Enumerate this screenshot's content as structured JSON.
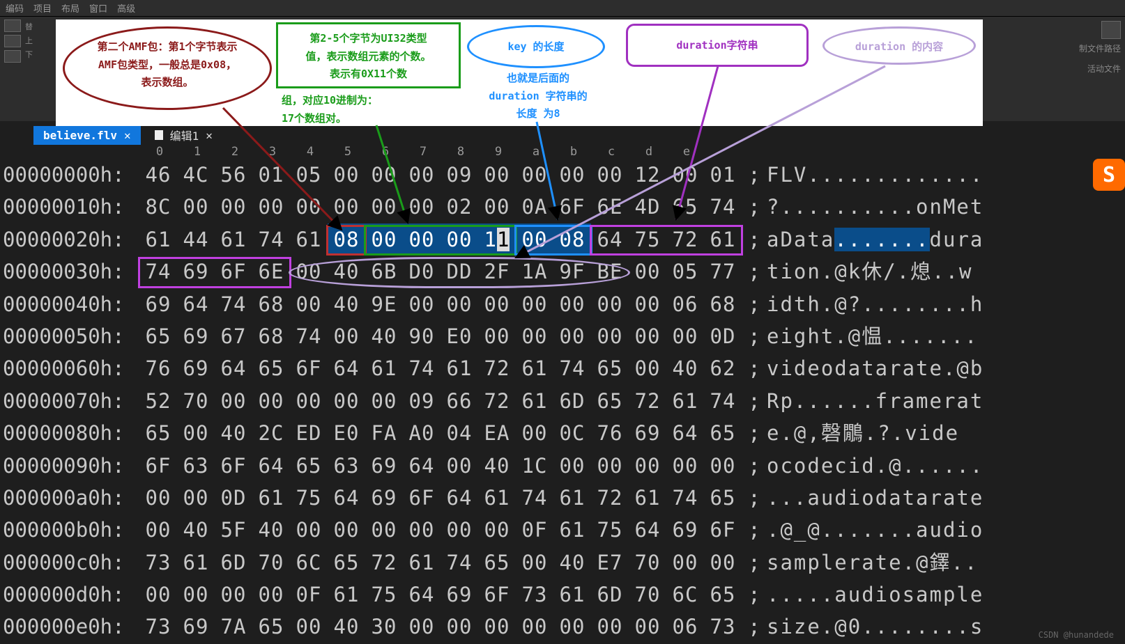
{
  "menu": [
    "编码",
    "项目",
    "布局",
    "窗口",
    "高级"
  ],
  "toolbar": {
    "left_items": [
      {
        "icon": "replace",
        "label": "替"
      },
      {
        "icon": "up",
        "label": "上"
      },
      {
        "icon": "down",
        "label": "下"
      }
    ]
  },
  "right_tools": {
    "line1": "制文件路径",
    "line2": "活动文件"
  },
  "csdn_watermark": "CSDN @hunandede",
  "annotations": {
    "amf_type": {
      "line1": "第二个AMF包：第1个字节表示",
      "line2": "AMF包类型，一般总是0x08，",
      "line3": "表示数组。"
    },
    "ui32": {
      "line1": "第2-5个字节为UI32类型",
      "line2": "值，表示数组元素的个数。",
      "line3": "表示有0X11个数",
      "extra1": "组，对应10进制为：",
      "extra2": "17个数组对。"
    },
    "key_len": {
      "title": "key 的长度",
      "sub1": "也就是后面的",
      "sub2": "duration 字符串的",
      "sub3": "长度 为8"
    },
    "dur_str": "duration字符串",
    "dur_content": "duration 的内容"
  },
  "tabs": [
    {
      "label": "believe.flv",
      "active": true,
      "closable": true
    },
    {
      "label": "编辑1",
      "active": false,
      "icon": true,
      "closable": true
    }
  ],
  "hex": {
    "col_headers": [
      "0",
      "1",
      "2",
      "3",
      "4",
      "5",
      "6",
      "7",
      "8",
      "9",
      "a",
      "b",
      "c",
      "d",
      "e"
    ],
    "rows": [
      {
        "addr": "00000000h:",
        "b": [
          "46",
          "4C",
          "56",
          "01",
          "05",
          "00",
          "00",
          "00",
          "09",
          "00",
          "00",
          "00",
          "00",
          "12",
          "00",
          "01"
        ],
        "a": "FLV............."
      },
      {
        "addr": "00000010h:",
        "b": [
          "8C",
          "00",
          "00",
          "00",
          "00",
          "00",
          "00",
          "00",
          "02",
          "00",
          "0A",
          "6F",
          "6E",
          "4D",
          "65",
          "74"
        ],
        "a": "?..........onMet"
      },
      {
        "addr": "00000020h:",
        "b": [
          "61",
          "44",
          "61",
          "74",
          "61",
          "08",
          "00",
          "00",
          "00",
          "11",
          "00",
          "08",
          "64",
          "75",
          "72",
          "61"
        ],
        "a": "aData.......dura"
      },
      {
        "addr": "00000030h:",
        "b": [
          "74",
          "69",
          "6F",
          "6E",
          "00",
          "40",
          "6B",
          "D0",
          "DD",
          "2F",
          "1A",
          "9F",
          "BE",
          "00",
          "05",
          "77"
        ],
        "a": "tion.@k休/.熄..w"
      },
      {
        "addr": "00000040h:",
        "b": [
          "69",
          "64",
          "74",
          "68",
          "00",
          "40",
          "9E",
          "00",
          "00",
          "00",
          "00",
          "00",
          "00",
          "00",
          "06",
          "68"
        ],
        "a": "idth.@?........h"
      },
      {
        "addr": "00000050h:",
        "b": [
          "65",
          "69",
          "67",
          "68",
          "74",
          "00",
          "40",
          "90",
          "E0",
          "00",
          "00",
          "00",
          "00",
          "00",
          "00",
          "0D"
        ],
        "a": "eight.@愠......."
      },
      {
        "addr": "00000060h:",
        "b": [
          "76",
          "69",
          "64",
          "65",
          "6F",
          "64",
          "61",
          "74",
          "61",
          "72",
          "61",
          "74",
          "65",
          "00",
          "40",
          "62"
        ],
        "a": "videodatarate.@b"
      },
      {
        "addr": "00000070h:",
        "b": [
          "52",
          "70",
          "00",
          "00",
          "00",
          "00",
          "00",
          "09",
          "66",
          "72",
          "61",
          "6D",
          "65",
          "72",
          "61",
          "74"
        ],
        "a": "Rp......framerat"
      },
      {
        "addr": "00000080h:",
        "b": [
          "65",
          "00",
          "40",
          "2C",
          "ED",
          "E0",
          "FA",
          "A0",
          "04",
          "EA",
          "00",
          "0C",
          "76",
          "69",
          "64",
          "65"
        ],
        "a": "e.@,磬鷳.?.vide"
      },
      {
        "addr": "00000090h:",
        "b": [
          "6F",
          "63",
          "6F",
          "64",
          "65",
          "63",
          "69",
          "64",
          "00",
          "40",
          "1C",
          "00",
          "00",
          "00",
          "00",
          "00"
        ],
        "a": "ocodecid.@......"
      },
      {
        "addr": "000000a0h:",
        "b": [
          "00",
          "00",
          "0D",
          "61",
          "75",
          "64",
          "69",
          "6F",
          "64",
          "61",
          "74",
          "61",
          "72",
          "61",
          "74",
          "65"
        ],
        "a": "...audiodatarate"
      },
      {
        "addr": "000000b0h:",
        "b": [
          "00",
          "40",
          "5F",
          "40",
          "00",
          "00",
          "00",
          "00",
          "00",
          "00",
          "0F",
          "61",
          "75",
          "64",
          "69",
          "6F"
        ],
        "a": ".@_@.......audio"
      },
      {
        "addr": "000000c0h:",
        "b": [
          "73",
          "61",
          "6D",
          "70",
          "6C",
          "65",
          "72",
          "61",
          "74",
          "65",
          "00",
          "40",
          "E7",
          "70",
          "00",
          "00"
        ],
        "a": "samplerate.@鐸.."
      },
      {
        "addr": "000000d0h:",
        "b": [
          "00",
          "00",
          "00",
          "00",
          "0F",
          "61",
          "75",
          "64",
          "69",
          "6F",
          "73",
          "61",
          "6D",
          "70",
          "6C",
          "65"
        ],
        "a": ".....audiosample"
      },
      {
        "addr": "000000e0h:",
        "b": [
          "73",
          "69",
          "7A",
          "65",
          "00",
          "40",
          "30",
          "00",
          "00",
          "00",
          "00",
          "00",
          "00",
          "00",
          "06",
          "73"
        ],
        "a": "size.@0........s"
      }
    ],
    "highlight": {
      "row": 2,
      "sel_cells": [
        5,
        6,
        7,
        8,
        9,
        10,
        11
      ],
      "cursor_cell": 9,
      "asc_sel_start": 5,
      "asc_sel_end": 11
    },
    "boxes": [
      {
        "cls": "hb-red",
        "row": 2,
        "c0": 5,
        "c1": 5
      },
      {
        "cls": "hb-green",
        "row": 2,
        "c0": 6,
        "c1": 9
      },
      {
        "cls": "hb-blue",
        "row": 2,
        "c0": 10,
        "c1": 11
      },
      {
        "cls": "hb-purple",
        "row": 2,
        "c0": 12,
        "c1": 15
      },
      {
        "cls": "hb-purple",
        "row": 3,
        "c0": 0,
        "c1": 3
      },
      {
        "cls": "hb-ell",
        "row": 3,
        "c0": 4,
        "c1": 12
      }
    ]
  },
  "sogou_icon": "S"
}
